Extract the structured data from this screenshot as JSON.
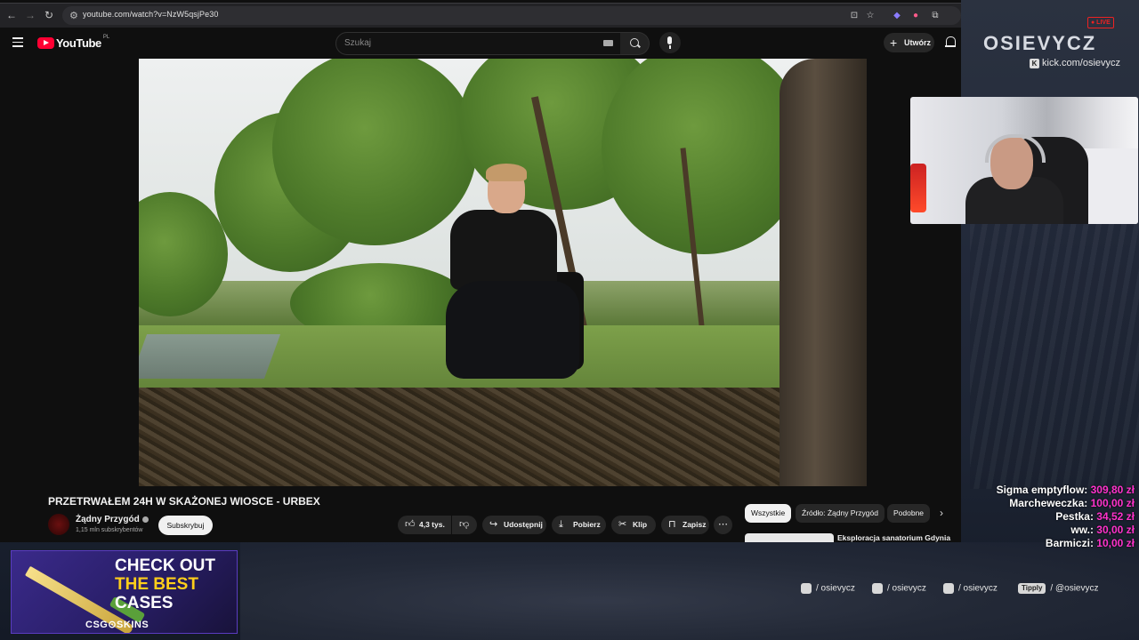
{
  "browser": {
    "url": "youtube.com/watch?v=NzW5qsjPe30",
    "icons": [
      "back-icon",
      "forward-icon",
      "reload-icon",
      "site-info-icon",
      "install-icon",
      "star-icon",
      "extension-icon",
      "extension-icon",
      "puzzle-icon"
    ]
  },
  "youtube": {
    "logo_text": "YouTube",
    "logo_country": "PL",
    "search_placeholder": "Szukaj",
    "create_label": "Utwórz",
    "video": {
      "title": "PRZETRWAŁEM 24H W SKAŻONEJ WIOSCE - URBEX",
      "channel_name": "Żądny Przygód",
      "subscribers": "1,15 mln subskrybentów",
      "subscribe_label": "Subskrybuj",
      "likes": "4,3 tys.",
      "share_label": "Udostępnij",
      "download_label": "Pobierz",
      "clip_label": "Klip",
      "save_label": "Zapisz"
    },
    "chips": [
      "Wszystkie",
      "Źródło: Żądny Przygód",
      "Podobne"
    ],
    "recommendation_title": "Eksploracja sanatorium Gdynia"
  },
  "overlay": {
    "live_badge": "● LIVE",
    "brand": "OSIEVYCZ",
    "kick_handle": "kick.com/osievycz",
    "donations": [
      {
        "name": "Sigma emptyflow:",
        "amount": "309,80 zł"
      },
      {
        "name": "Marcheweczka:",
        "amount": "100,00 zł"
      },
      {
        "name": "Pestka:",
        "amount": "34,52 zł"
      },
      {
        "name": "ww.:",
        "amount": "30,00 zł"
      },
      {
        "name": "Barmiczi:",
        "amount": "10,00 zł"
      }
    ],
    "socials": [
      {
        "icon": "instagram-icon",
        "handle": "/ osievycz"
      },
      {
        "icon": "tiktok-icon",
        "handle": "/ osievycz"
      },
      {
        "icon": "youtube-icon",
        "handle": "/ osievycz"
      }
    ],
    "tipply": {
      "label": "Tipply",
      "handle": "/ @osievycz"
    },
    "ad": {
      "line1": "CHECK OUT",
      "line2": "THE BEST",
      "line3": "CASES",
      "logo": "CSG⊙SKINS"
    }
  },
  "colors": {
    "youtube_red": "#ff0033",
    "donation_amount": "#ff33cc",
    "live_red": "#ee2222"
  }
}
